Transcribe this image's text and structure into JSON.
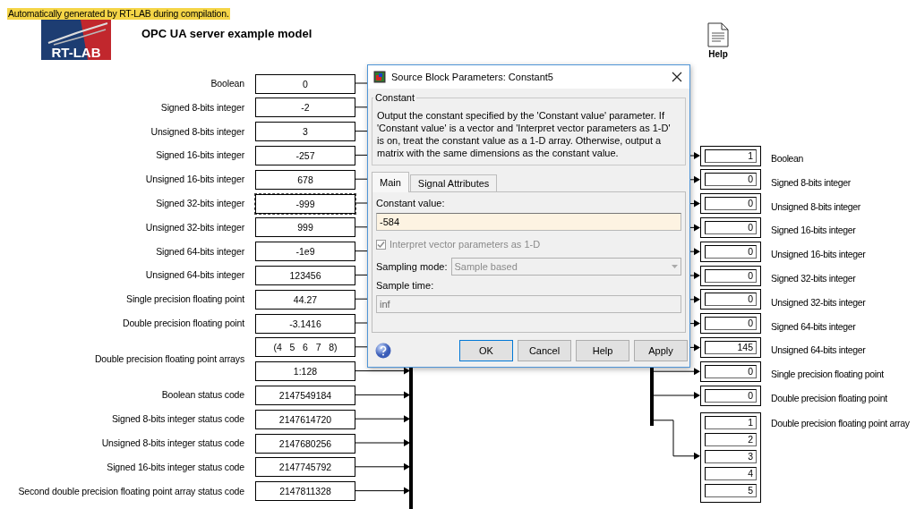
{
  "banner": "Automatically generated by RT-LAB during compilation.",
  "logo": {
    "text": "RT-LAB"
  },
  "title": "OPC UA server example model",
  "help_block": {
    "label": "Help"
  },
  "inputs": [
    {
      "kind": "scalar",
      "label": "Boolean",
      "values": [
        "0"
      ]
    },
    {
      "kind": "scalar",
      "label": "Signed 8-bits integer",
      "values": [
        "-2"
      ]
    },
    {
      "kind": "scalar",
      "label": "Unsigned 8-bits integer",
      "values": [
        "3"
      ]
    },
    {
      "kind": "scalar",
      "label": "Signed 16-bits integer",
      "values": [
        "-257"
      ]
    },
    {
      "kind": "scalar",
      "label": "Unsigned 16-bits integer",
      "values": [
        "678"
      ]
    },
    {
      "kind": "scalar",
      "label": "Signed 32-bits integer",
      "values": [
        "-999"
      ],
      "selected": true
    },
    {
      "kind": "scalar",
      "label": "Unsigned 32-bits integer",
      "values": [
        "999"
      ]
    },
    {
      "kind": "scalar",
      "label": "Signed 64-bits integer",
      "values": [
        "-1e9"
      ]
    },
    {
      "kind": "scalar",
      "label": "Unsigned 64-bits integer",
      "values": [
        "123456"
      ]
    },
    {
      "kind": "scalar",
      "label": "Single precision floating point",
      "values": [
        "44.27"
      ]
    },
    {
      "kind": "scalar",
      "label": "Double precision floating point",
      "values": [
        "-3.1416"
      ]
    },
    {
      "kind": "array",
      "label": "Double precision floating point arrays",
      "values": [
        "(4   5   6   7   8)",
        "1:128"
      ]
    },
    {
      "kind": "scalar",
      "label": "Boolean status code",
      "values": [
        "2147549184"
      ]
    },
    {
      "kind": "scalar",
      "label": "Signed 8-bits integer status code",
      "values": [
        "2147614720"
      ]
    },
    {
      "kind": "scalar",
      "label": "Unsigned 8-bits integer status code",
      "values": [
        "2147680256"
      ]
    },
    {
      "kind": "scalar",
      "label": "Signed 16-bits integer status code",
      "values": [
        "2147745792"
      ]
    },
    {
      "kind": "scalar",
      "label": "Second double precision floating point array status code",
      "values": [
        "2147811328"
      ]
    }
  ],
  "outputs": [
    {
      "kind": "scalar",
      "label": "Boolean",
      "values": [
        "1"
      ]
    },
    {
      "kind": "scalar",
      "label": "Signed 8-bits integer",
      "values": [
        "0"
      ]
    },
    {
      "kind": "scalar",
      "label": "Unsigned 8-bits integer",
      "values": [
        "0"
      ]
    },
    {
      "kind": "scalar",
      "label": "Signed 16-bits integer",
      "values": [
        "0"
      ]
    },
    {
      "kind": "scalar",
      "label": "Unsigned 16-bits integer",
      "values": [
        "0"
      ]
    },
    {
      "kind": "scalar",
      "label": "Signed 32-bits integer",
      "values": [
        "0"
      ]
    },
    {
      "kind": "scalar",
      "label": "Unsigned 32-bits integer",
      "values": [
        "0"
      ]
    },
    {
      "kind": "scalar",
      "label": "Signed 64-bits integer",
      "values": [
        "0"
      ]
    },
    {
      "kind": "scalar",
      "label": "Unsigned 64-bits integer",
      "values": [
        "145"
      ]
    },
    {
      "kind": "scalar",
      "label": "Single precision floating point",
      "values": [
        "0"
      ]
    },
    {
      "kind": "scalar",
      "label": "Double precision floating point",
      "values": [
        "0"
      ]
    },
    {
      "kind": "array",
      "label": "Double precision floating point array",
      "values": [
        "1",
        "2",
        "3",
        "4",
        "5"
      ]
    }
  ],
  "dialog": {
    "title": "Source Block Parameters: Constant5",
    "group_title": "Constant",
    "description": "Output the constant specified by the 'Constant value' parameter. If 'Constant value' is a vector and 'Interpret vector parameters as 1-D' is on, treat the constant value as a 1-D array. Otherwise, output a matrix with the same dimensions as the constant value.",
    "tabs": [
      {
        "label": "Main",
        "selected": true
      },
      {
        "label": "Signal Attributes",
        "selected": false
      }
    ],
    "constant_value": {
      "label": "Constant value:",
      "value": "-584"
    },
    "interpret_1d": {
      "label": "Interpret vector parameters as 1-D",
      "checked": true,
      "disabled": true
    },
    "sampling_mode": {
      "label": "Sampling mode:",
      "value": "Sample based",
      "disabled": true
    },
    "sample_time": {
      "label": "Sample time:",
      "value": "inf",
      "disabled": true
    },
    "buttons": [
      "OK",
      "Cancel",
      "Help",
      "Apply"
    ]
  }
}
